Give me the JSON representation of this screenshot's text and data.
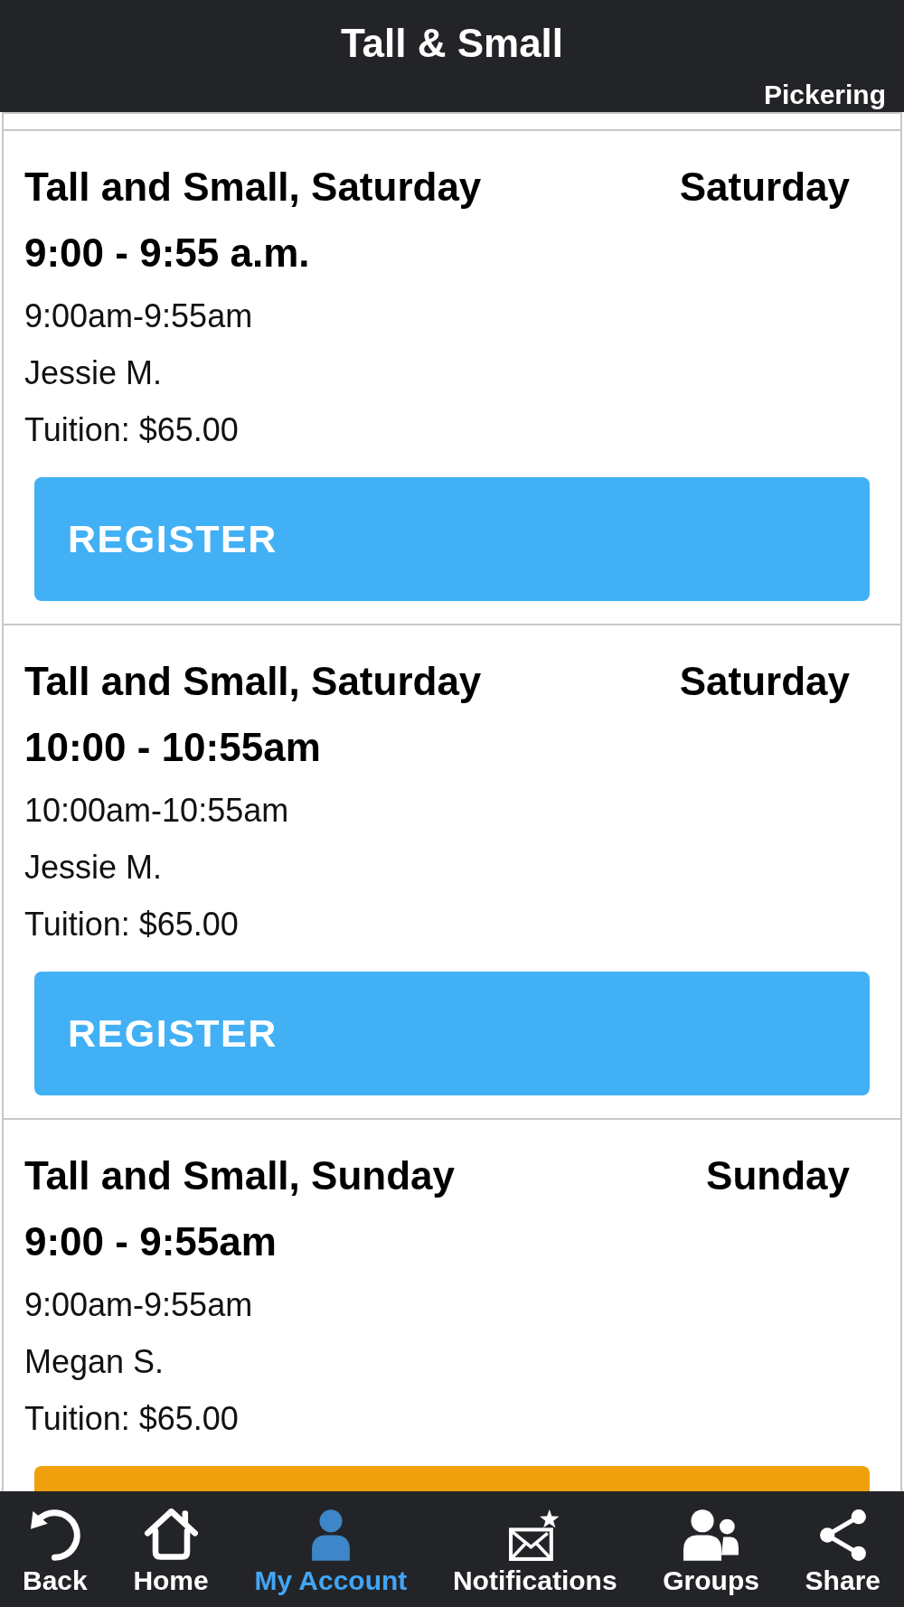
{
  "header": {
    "title": "Tall & Small",
    "location": "Pickering"
  },
  "classes": [
    {
      "title": "Tall and Small, Saturday",
      "day": "Saturday",
      "time": "9:00 - 9:55 a.m.",
      "hours": "9:00am-9:55am",
      "instructor": "Jessie M.",
      "tuition": "Tuition: $65.00",
      "button": {
        "label": "REGISTER",
        "color": "#42b0f5"
      }
    },
    {
      "title": "Tall and Small, Saturday",
      "day": "Saturday",
      "time": "10:00 - 10:55am",
      "hours": "10:00am-10:55am",
      "instructor": "Jessie M.",
      "tuition": "Tuition: $65.00",
      "button": {
        "label": "REGISTER",
        "color": "#42b0f5"
      }
    },
    {
      "title": "Tall and Small, Sunday",
      "day": "Sunday",
      "time": "9:00 - 9:55am",
      "hours": "9:00am-9:55am",
      "instructor": "Megan S.",
      "tuition": "Tuition: $65.00",
      "button": {
        "color": "#f0a00c"
      }
    }
  ],
  "nav": [
    {
      "kind": "back",
      "label": "Back",
      "selected": false
    },
    {
      "kind": "home",
      "label": "Home",
      "selected": false
    },
    {
      "kind": "account",
      "label": "My Account",
      "selected": true
    },
    {
      "kind": "notifications",
      "label": "Notifications",
      "selected": false
    },
    {
      "kind": "groups",
      "label": "Groups",
      "selected": false
    },
    {
      "kind": "share",
      "label": "Share",
      "selected": false
    }
  ]
}
